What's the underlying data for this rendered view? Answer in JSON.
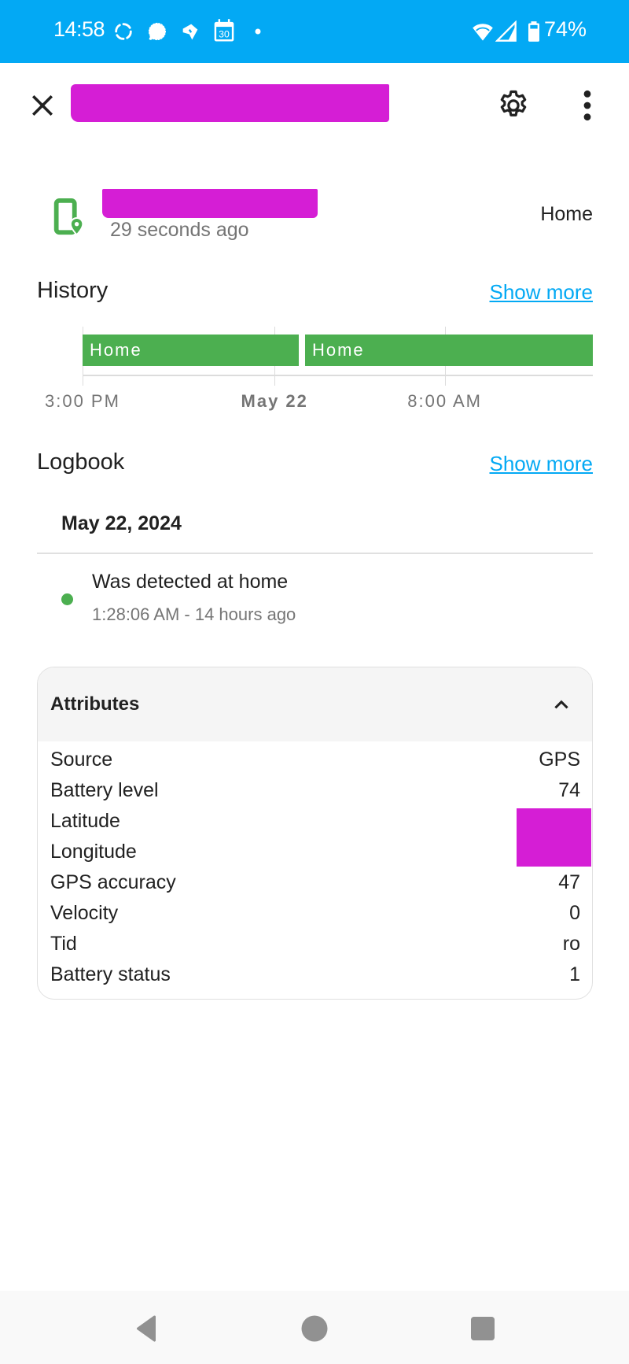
{
  "status_bar": {
    "time": "14:58",
    "notification_icons": [
      "sync-icon",
      "signal-messenger-icon",
      "app-notification-icon",
      "calendar-icon",
      "more-notifications-dot-icon"
    ],
    "calendar_day": "30",
    "system_icons": [
      "wifi-icon",
      "cell-signal-icon",
      "battery-icon"
    ],
    "battery_percent": "74%",
    "background_color": "#03a9f4"
  },
  "toolbar": {
    "title": "[redacted]",
    "close_icon": "close-icon",
    "settings_icon": "gear-icon",
    "more_icon": "more-vert-icon"
  },
  "entity": {
    "name": "[redacted]",
    "last_changed": "29 seconds ago",
    "state": "Home",
    "icon": "cellphone-marker-icon",
    "icon_color": "#4caf50"
  },
  "history": {
    "title": "History",
    "show_more": "Show more",
    "bars": [
      {
        "label": "Home",
        "start_fraction": 0.0,
        "end_fraction": 0.424
      },
      {
        "label": "Home",
        "start_fraction": 0.436,
        "end_fraction": 1.0
      }
    ],
    "ticks": [
      {
        "label": "3:00 PM",
        "fraction": 0.0,
        "bold": false
      },
      {
        "label": "May 22",
        "fraction": 0.376,
        "bold": true
      },
      {
        "label": "8:00 AM",
        "fraction": 0.71,
        "bold": false
      }
    ],
    "bar_color": "#4caf50"
  },
  "logbook": {
    "title": "Logbook",
    "show_more": "Show more",
    "date_header": "May 22, 2024",
    "entries": [
      {
        "message": "Was detected at home",
        "time": "1:28:06 AM - 14 hours ago"
      }
    ]
  },
  "attributes": {
    "title": "Attributes",
    "expanded": true,
    "rows": [
      {
        "key": "Source",
        "value": "GPS"
      },
      {
        "key": "Battery level",
        "value": "74"
      },
      {
        "key": "Latitude",
        "value": "[redacted]"
      },
      {
        "key": "Longitude",
        "value": "[redacted]"
      },
      {
        "key": "GPS accuracy",
        "value": "47"
      },
      {
        "key": "Velocity",
        "value": "0"
      },
      {
        "key": "Tid",
        "value": "ro"
      },
      {
        "key": "Battery status",
        "value": "1"
      }
    ]
  },
  "nav_bar": {
    "buttons": [
      "back",
      "home",
      "recents"
    ]
  },
  "colors": {
    "accent": "#03a9f4",
    "state_green": "#4caf50",
    "redaction": "#d51ed5"
  }
}
